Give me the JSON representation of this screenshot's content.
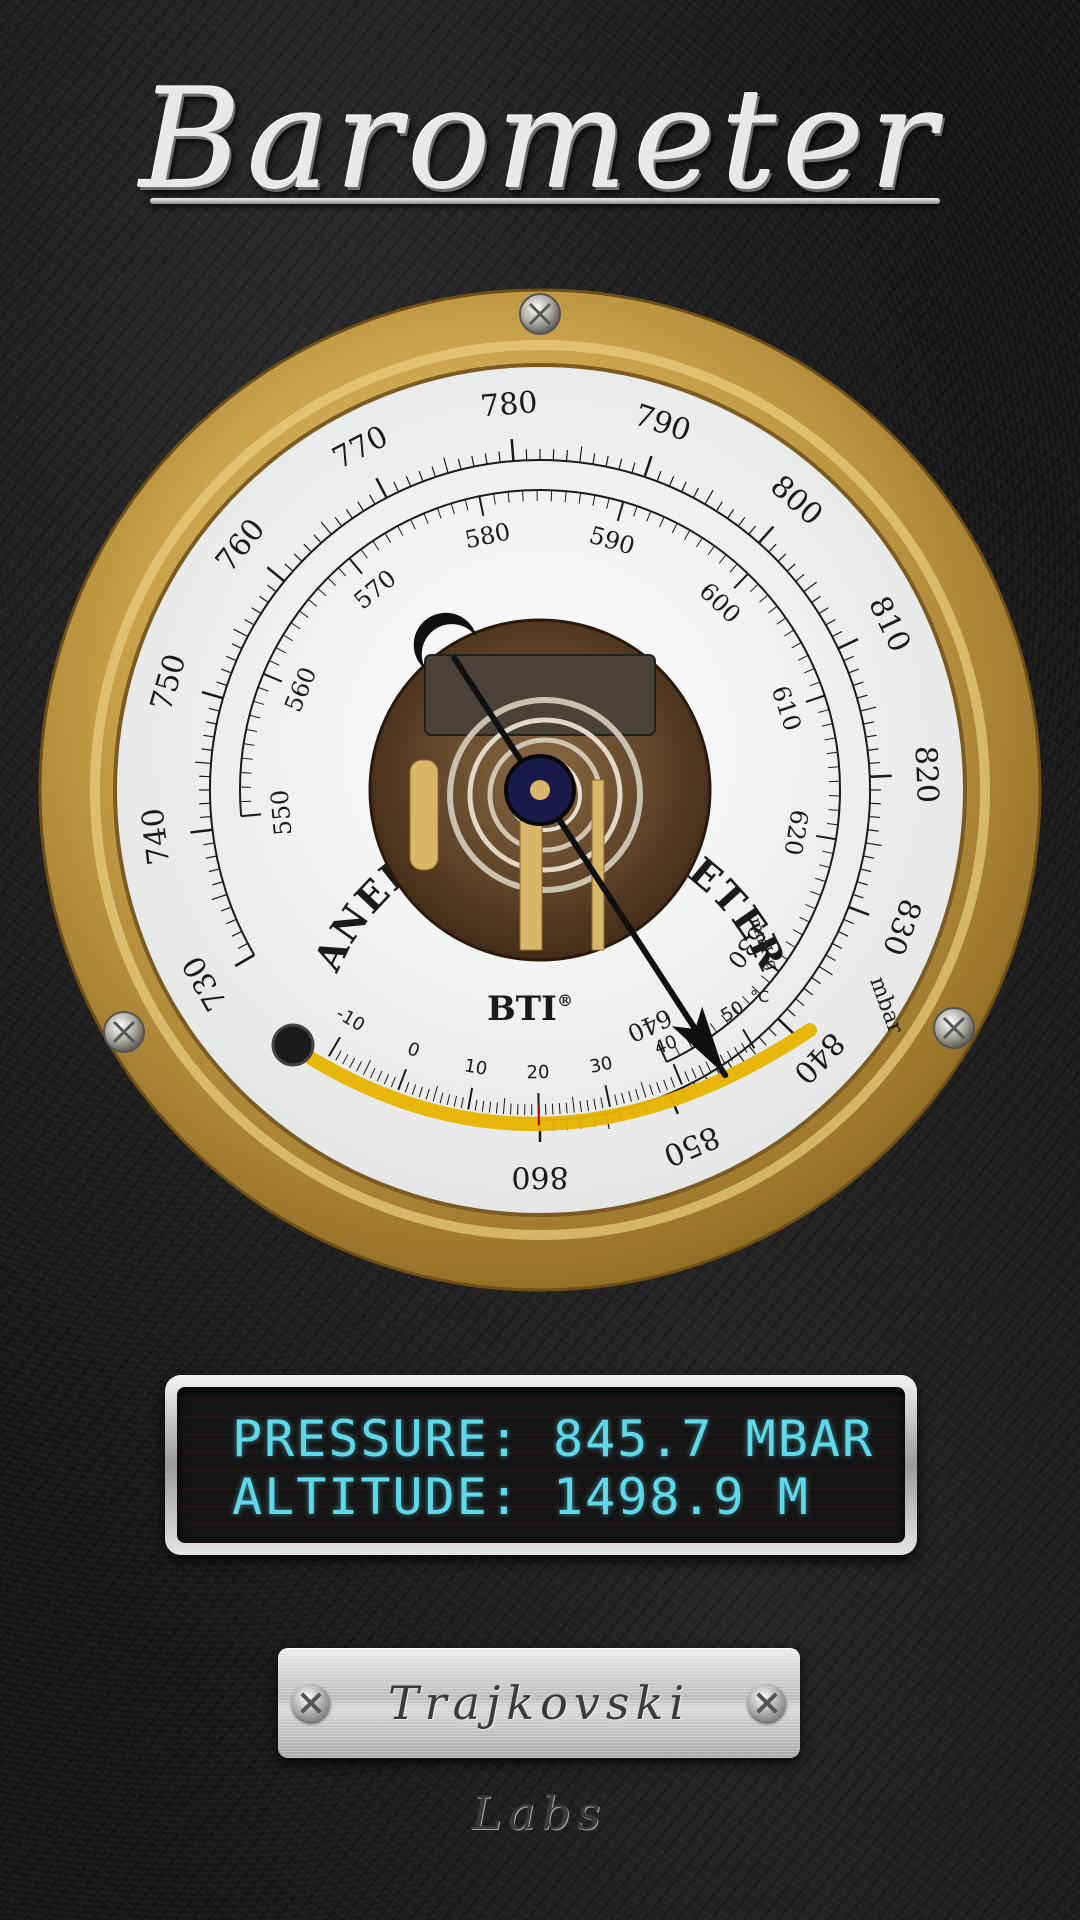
{
  "app": {
    "title": "Barometer"
  },
  "gauge": {
    "face_title": "ANEROID BAROMETER",
    "brand": "BTI",
    "brand_mark": "®",
    "outer_scale": {
      "unit": "mbar",
      "labels": [
        "730",
        "740",
        "750",
        "760",
        "770",
        "780",
        "790",
        "800",
        "810",
        "820",
        "830",
        "840",
        "850",
        "860"
      ],
      "min": 730,
      "max": 860
    },
    "inner_scale": {
      "unit": "mmHg",
      "labels": [
        "550",
        "560",
        "570",
        "580",
        "590",
        "600",
        "610",
        "620",
        "630",
        "640"
      ],
      "min": 550,
      "max": 640
    },
    "thermometer": {
      "unit": "°C",
      "labels": [
        "-10",
        "0",
        "10",
        "20",
        "30",
        "40",
        "50"
      ],
      "min": -10,
      "max": 50,
      "reading": 20
    },
    "needle_value_mbar": 845.7,
    "colors": {
      "brass": "#c9a14a",
      "face": "#f2f2ee",
      "fluid": "#e8b400",
      "ink": "#1a1a1a"
    }
  },
  "display": {
    "pressure_line": "PRESSURE: 845.7 MBAR",
    "altitude_line": "ALTITUDE: 1498.9 M",
    "text_color": "#5fd8ea"
  },
  "footer": {
    "brand": "Trajkovski Labs"
  }
}
